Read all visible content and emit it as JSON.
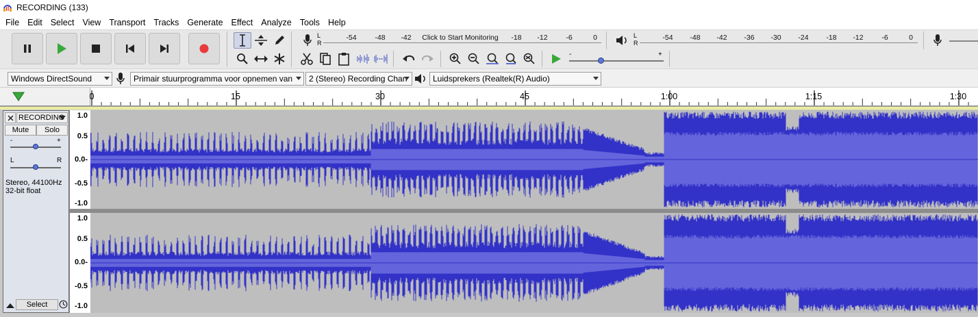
{
  "window": {
    "title": "RECORDING (133)"
  },
  "menu": [
    "File",
    "Edit",
    "Select",
    "View",
    "Transport",
    "Tracks",
    "Generate",
    "Effect",
    "Analyze",
    "Tools",
    "Help"
  ],
  "record_meter": {
    "ticks": [
      "-54",
      "-48",
      "-42",
      "Click to Start Monitoring",
      "-18",
      "-12",
      "-6",
      "0"
    ],
    "lr": [
      "L",
      "R"
    ]
  },
  "play_meter": {
    "ticks": [
      "-54",
      "-48",
      "-42",
      "-36",
      "-30",
      "-24",
      "-18",
      "-12",
      "-6",
      "0"
    ],
    "lr": [
      "L",
      "R"
    ]
  },
  "playback_speed": {
    "minus": "-",
    "plus": "+"
  },
  "devices": {
    "host": "Windows DirectSound",
    "recording_device": "Primair stuurprogramma voor opnemen van",
    "channels": "2 (Stereo) Recording Chan",
    "playback_device": "Luidsprekers (Realtek(R) Audio)"
  },
  "timeline": {
    "labels": [
      "0",
      "15",
      "30",
      "45",
      "1:00",
      "1:15",
      "1:30"
    ]
  },
  "track": {
    "name": "RECORDING",
    "mute": "Mute",
    "solo": "Solo",
    "gain_minus": "-",
    "gain_plus": "+",
    "pan_left": "L",
    "pan_right": "R",
    "info_line1": "Stereo, 44100Hz",
    "info_line2": "32-bit float",
    "select": "Select",
    "scale": [
      "1.0",
      "0.5",
      "0.0-",
      "-0.5",
      "-1.0"
    ]
  },
  "colors": {
    "wave": "#3232c8",
    "wave_rms": "#6464dc",
    "track_bg": "#bebebe",
    "record_red": "#e83a3a",
    "play_green": "#3aa83a"
  }
}
